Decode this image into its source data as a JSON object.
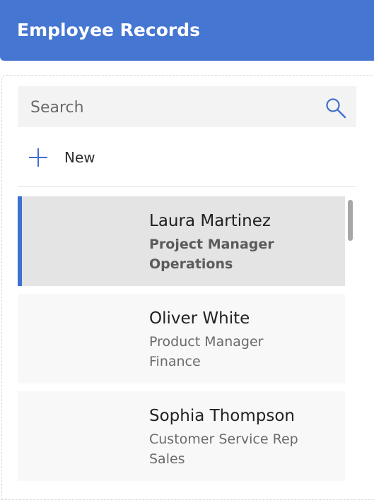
{
  "header": {
    "title": "Employee Records"
  },
  "search": {
    "placeholder": "Search",
    "value": "",
    "icon": "search-icon"
  },
  "actions": {
    "new_label": "New",
    "new_icon": "plus-icon"
  },
  "colors": {
    "header_bg": "#4576d1",
    "accent": "#3f6fd0",
    "selected_bg": "#e4e4e4",
    "item_bg": "#f8f8f8"
  },
  "employees": [
    {
      "name": "Laura Martinez",
      "title": "Project Manager",
      "department": "Operations",
      "selected": true
    },
    {
      "name": "Oliver White",
      "title": "Product Manager",
      "department": "Finance",
      "selected": false
    },
    {
      "name": "Sophia Thompson",
      "title": "Customer Service Rep",
      "department": "Sales",
      "selected": false
    }
  ]
}
